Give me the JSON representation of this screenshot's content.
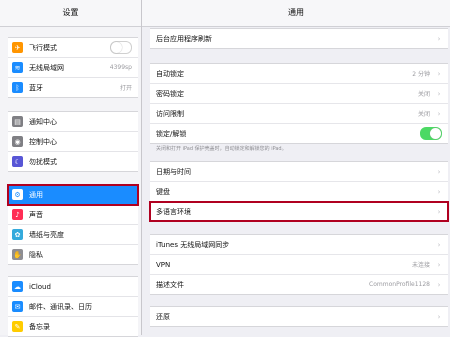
{
  "sidebar": {
    "title": "设置",
    "items": [
      {
        "label": "飞行模式",
        "icon": "airplane-icon",
        "color": "#ff9500"
      },
      {
        "label": "无线局域网",
        "value": "4399sp",
        "icon": "wifi-icon",
        "color": "#1a8cff"
      },
      {
        "label": "蓝牙",
        "value": "打开",
        "icon": "bluetooth-icon",
        "color": "#1a8cff"
      },
      {
        "label": "通知中心",
        "icon": "notification-icon",
        "color": "#7f7f84"
      },
      {
        "label": "控制中心",
        "icon": "control-center-icon",
        "color": "#7f7f84"
      },
      {
        "label": "勿扰模式",
        "icon": "moon-icon",
        "color": "#5856d6"
      },
      {
        "label": "通用",
        "icon": "gear-icon",
        "color": "#8e8e93"
      },
      {
        "label": "声音",
        "icon": "speaker-icon",
        "color": "#ff2d55"
      },
      {
        "label": "墙纸与亮度",
        "icon": "wallpaper-icon",
        "color": "#34aadc"
      },
      {
        "label": "隐私",
        "icon": "hand-icon",
        "color": "#8e8e93"
      },
      {
        "label": "iCloud",
        "icon": "cloud-icon",
        "color": "#1a8cff"
      },
      {
        "label": "邮件、通讯录、日历",
        "icon": "mail-icon",
        "color": "#1a8cff"
      },
      {
        "label": "备忘录",
        "icon": "notes-icon",
        "color": "#ffcc00"
      }
    ]
  },
  "main": {
    "title": "通用",
    "group1": [
      {
        "label": "后台应用程序刷新"
      }
    ],
    "group2": [
      {
        "label": "自动锁定",
        "value": "2 分钟"
      },
      {
        "label": "密码锁定",
        "value": "关闭"
      },
      {
        "label": "访问限制",
        "value": "关闭"
      },
      {
        "label": "锁定/解锁"
      }
    ],
    "note": "关闭和打开 iPad 保护壳盖时，自动锁定和解锁您的 iPad。",
    "group3": [
      {
        "label": "日期与时间"
      },
      {
        "label": "键盘"
      },
      {
        "label": "多语言环境"
      }
    ],
    "group4": [
      {
        "label": "iTunes 无线局域网同步"
      },
      {
        "label": "VPN",
        "value": "未连接"
      },
      {
        "label": "描述文件",
        "value": "CommonProfile1128"
      }
    ],
    "group5": [
      {
        "label": "还原"
      }
    ]
  },
  "chevron": "›",
  "toggles": {
    "airplane": false,
    "lock_unlock": true
  }
}
